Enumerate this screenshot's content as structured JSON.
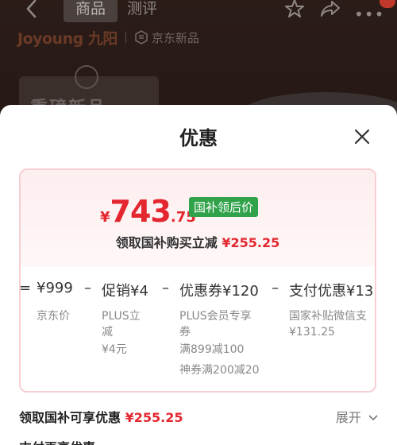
{
  "topbar": {
    "tabs": [
      "商品",
      "测评"
    ],
    "brand": "Joyoung 九阳",
    "store_label": "京东新品"
  },
  "background": {
    "promo_text": "重磅新品"
  },
  "sheet": {
    "title": "优惠",
    "price": {
      "currency": "¥",
      "integer": "743",
      "decimal": ".75",
      "tag": "国补领后价"
    },
    "subsidy": {
      "label": "领取国补购买立减",
      "amount": "¥255.25"
    },
    "breakdown": {
      "eq": "=",
      "base": {
        "value": "¥999",
        "label": "京东价"
      },
      "items": [
        {
          "op": "–",
          "value": "促销¥4",
          "lines": [
            "PLUS立",
            "减",
            "¥4元"
          ]
        },
        {
          "op": "–",
          "value": "优惠券¥120",
          "lines": [
            "PLUS会员专享",
            "券",
            "满899减100",
            "神券满200减20"
          ]
        },
        {
          "op": "–",
          "value": "支付优惠¥13",
          "lines": [
            "国家补贴微信支",
            "¥131.25"
          ]
        }
      ]
    },
    "footer": {
      "label": "领取国补可享优惠",
      "amount": "¥255.25",
      "expand": "展开",
      "next_label": "支付再享优惠"
    }
  },
  "colors": {
    "accent_red": "#e4262f",
    "tag_green": "#2fa24a",
    "card_border": "#f6cfd2"
  }
}
